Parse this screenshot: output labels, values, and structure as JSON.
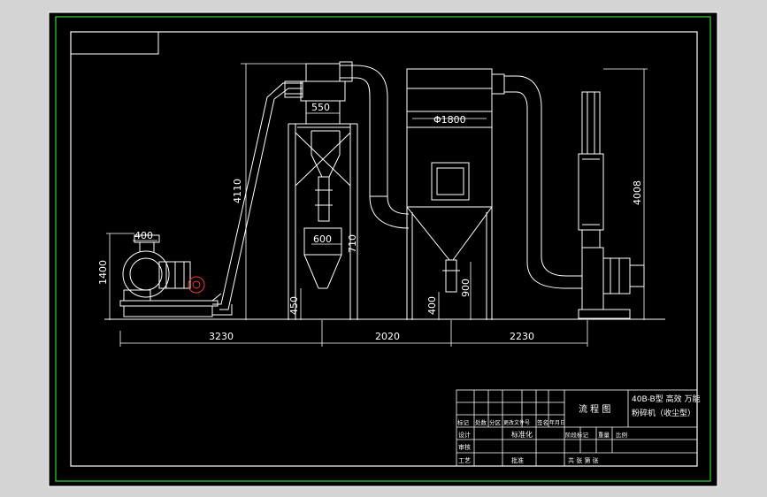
{
  "drawing": {
    "dimensions": {
      "d550": "550",
      "d1800": "Φ1800",
      "d400": "400",
      "d600": "600",
      "d710": "710",
      "d4110": "4110",
      "d1400": "1400",
      "d450": "450",
      "d400b": "400",
      "d900": "900",
      "d4008": "4008",
      "d3230": "3230",
      "d2020": "2020",
      "d2230": "2230"
    },
    "title_block": {
      "sheet_name": "流 程 图",
      "product_line1": "40B-B型 高效 万能",
      "product_line2": "粉碎机（收尘型）",
      "std_label": "标准化",
      "approve_label": "批准",
      "total_sheets": "共  张  第  张",
      "header_cells": [
        "标记",
        "处数",
        "分区",
        "更改文件号",
        "签名",
        "年月日"
      ],
      "rows": [
        "设计",
        "审核",
        "工艺"
      ],
      "stage_cells": [
        "阶段标记",
        "重量",
        "比例"
      ]
    }
  }
}
